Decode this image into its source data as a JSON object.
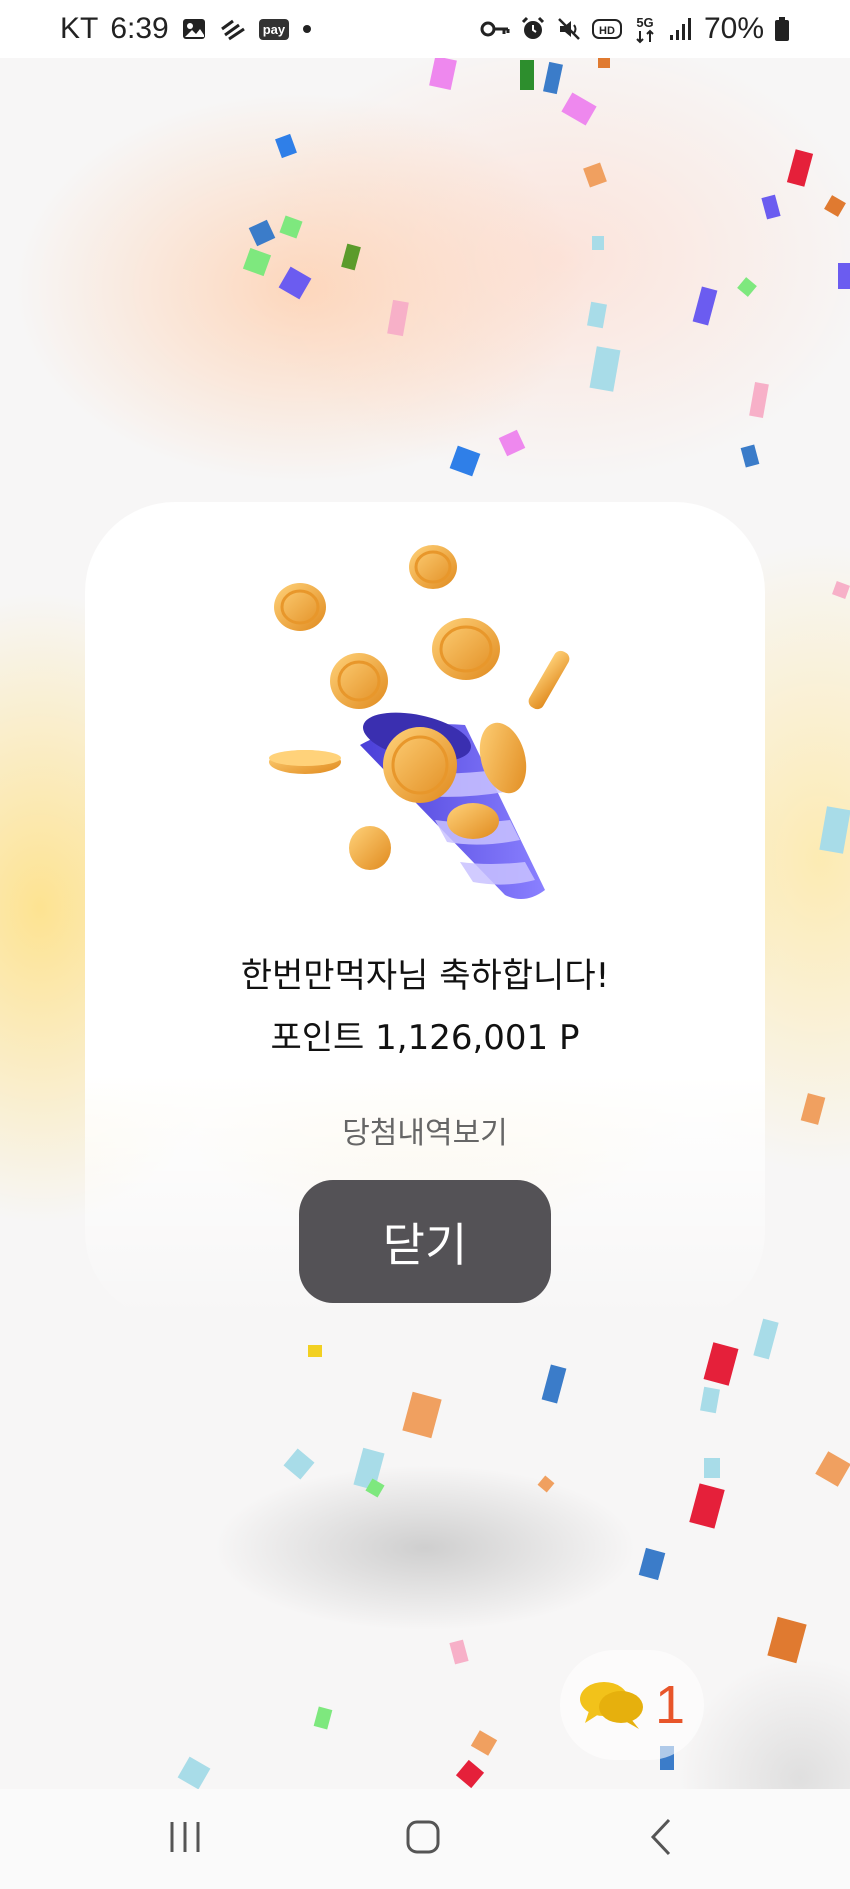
{
  "status_bar": {
    "carrier": "KT",
    "time": "6:39",
    "pay_icon_label": "pay",
    "battery": "70%",
    "left_icons": [
      "gallery-icon",
      "wifi-direct-icon",
      "pay-icon",
      "dot-icon"
    ],
    "right_icons": [
      "key-icon",
      "alarm-icon",
      "mute-icon",
      "hd-icon",
      "5g-icon",
      "signal-icon",
      "battery-icon"
    ]
  },
  "dialog": {
    "congrats_message": "한번만먹자님 축하합니다!",
    "points_text": "포인트 1,126,001 P",
    "history_link": "당첨내역보기",
    "close_label": "닫기"
  },
  "chat": {
    "icon": "chat-bubbles-icon",
    "unread_count": "1"
  },
  "nav": {
    "icons": [
      "recent-apps-icon",
      "home-icon",
      "back-icon"
    ]
  },
  "colors": {
    "close_button_bg": "#545256",
    "chat_count": "#e8552a",
    "coin": "#f0a83a",
    "cone_purple": "#6b5cf0"
  }
}
